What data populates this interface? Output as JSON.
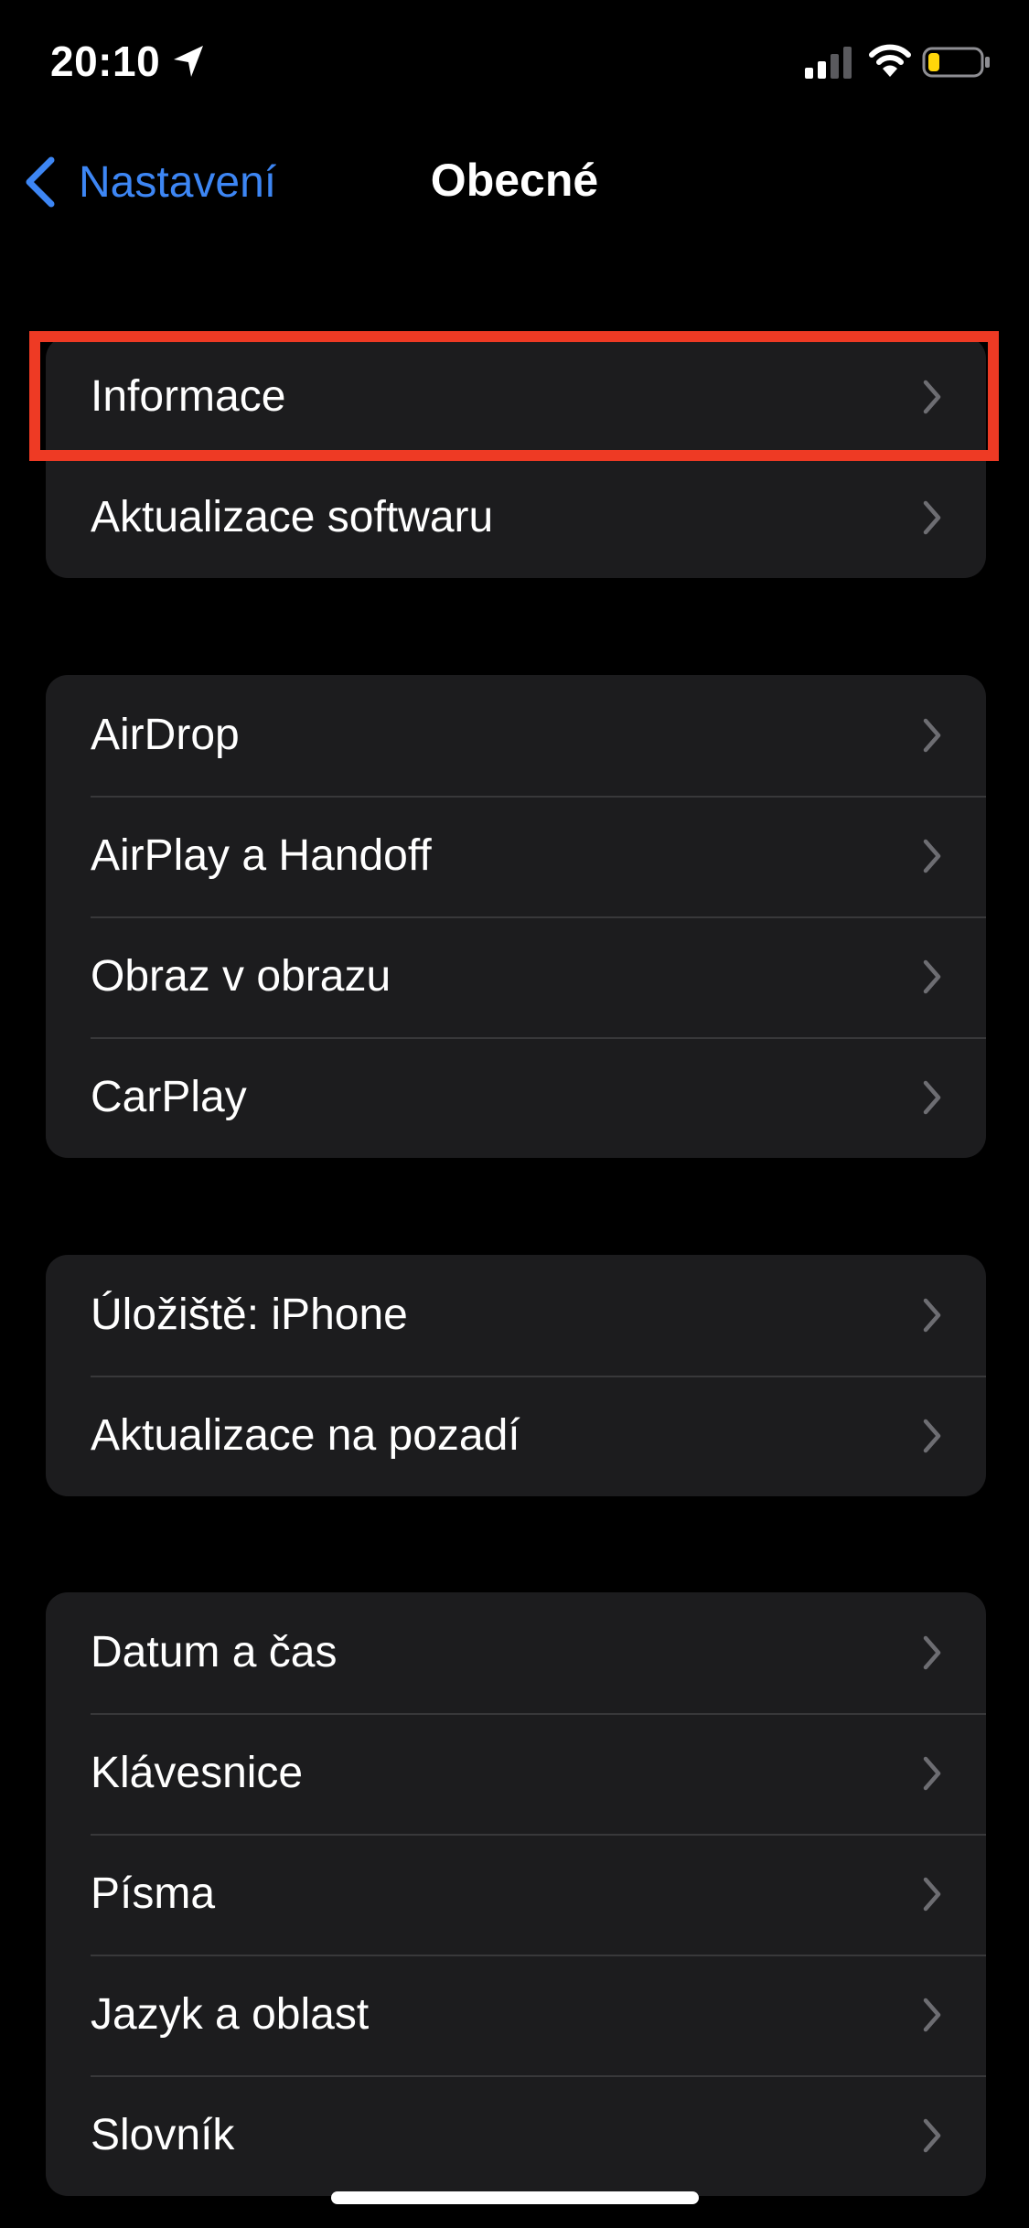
{
  "status_bar": {
    "time": "20:10",
    "location_icon": "location-arrow-icon",
    "signal_icon": "cellular-signal-icon",
    "wifi_icon": "wifi-icon",
    "battery_icon": "battery-low-icon"
  },
  "nav": {
    "back_label": "Nastavení",
    "title": "Obecné"
  },
  "groups": [
    {
      "rows": [
        {
          "label": "Informace"
        },
        {
          "label": "Aktualizace softwaru"
        }
      ]
    },
    {
      "rows": [
        {
          "label": "AirDrop"
        },
        {
          "label": "AirPlay a Handoff"
        },
        {
          "label": "Obraz v obrazu"
        },
        {
          "label": "CarPlay"
        }
      ]
    },
    {
      "rows": [
        {
          "label": "Úložiště: iPhone"
        },
        {
          "label": "Aktualizace na pozadí"
        }
      ]
    },
    {
      "rows": [
        {
          "label": "Datum a čas"
        },
        {
          "label": "Klávesnice"
        },
        {
          "label": "Písma"
        },
        {
          "label": "Jazyk a oblast"
        },
        {
          "label": "Slovník"
        }
      ]
    }
  ],
  "colors": {
    "background": "#000000",
    "cell_background": "#1c1c1e",
    "accent": "#3d86f4",
    "separator": "#38383a",
    "chevron": "#6d6d72",
    "highlight": "#ee3a24",
    "battery_level": "#ffd60a"
  }
}
